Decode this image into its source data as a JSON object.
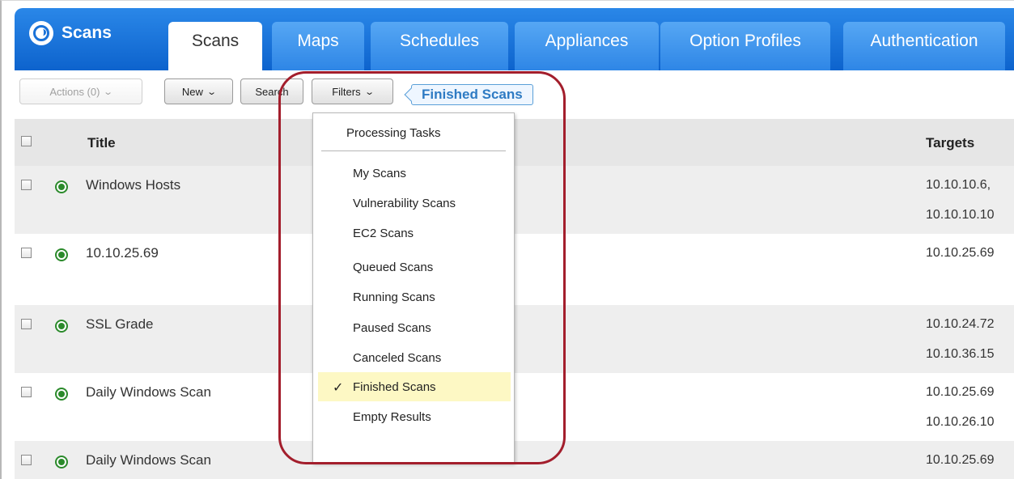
{
  "nav": {
    "brand": "Scans",
    "tabs": [
      {
        "label": "Scans",
        "active": true
      },
      {
        "label": "Maps",
        "active": false
      },
      {
        "label": "Schedules",
        "active": false
      },
      {
        "label": "Appliances",
        "active": false
      },
      {
        "label": "Option Profiles",
        "active": false
      },
      {
        "label": "Authentication",
        "active": false
      }
    ]
  },
  "toolbar": {
    "actions_label": "Actions (0)",
    "new_label": "New",
    "search_label": "Search",
    "filters_label": "Filters",
    "active_filter": "Finished Scans"
  },
  "table": {
    "columns": {
      "title": "Title",
      "targets": "Targets"
    },
    "rows": [
      {
        "title": "Windows Hosts",
        "targets": [
          "10.10.10.6,",
          "10.10.10.10"
        ]
      },
      {
        "title": "10.10.25.69",
        "targets": [
          "10.10.25.69"
        ]
      },
      {
        "title": "SSL Grade",
        "targets": [
          "10.10.24.72",
          "10.10.36.15"
        ]
      },
      {
        "title": "Daily Windows Scan",
        "targets": [
          "10.10.25.69",
          "10.10.26.10"
        ]
      },
      {
        "title": "Daily Windows Scan",
        "targets": [
          "10.10.25.69"
        ]
      }
    ]
  },
  "filter_menu": {
    "items": [
      "Processing Tasks",
      "My Scans",
      "Vulnerability Scans",
      "EC2 Scans",
      "Queued Scans",
      "Running Scans",
      "Paused Scans",
      "Canceled Scans",
      "Finished Scans",
      "Empty Results"
    ],
    "selected": "Finished Scans",
    "check_mark": "✓"
  },
  "colors": {
    "nav_blue": "#0d63cd",
    "tab_blue": "#2e86e6",
    "status_green": "#2b8a2b",
    "highlight_red": "#a31e2c",
    "selected_yellow": "#fdf8c4"
  }
}
